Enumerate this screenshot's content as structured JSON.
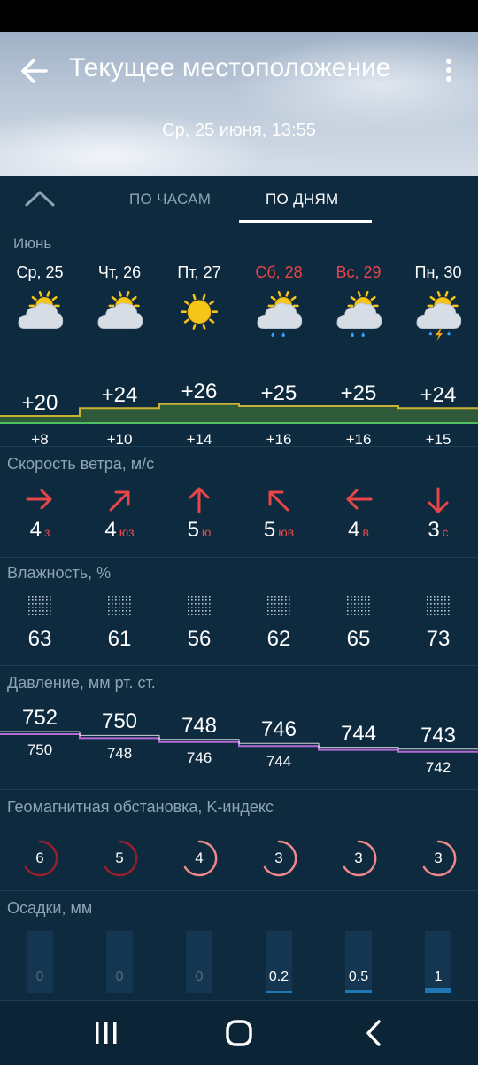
{
  "header": {
    "title": "Текущее местоположение",
    "date": "Ср, 25 июня, 13:55"
  },
  "tabs": {
    "hourly": "ПО ЧАСАМ",
    "daily": "ПО ДНЯМ",
    "active": "daily"
  },
  "month": "Июнь",
  "days": [
    {
      "name": "Ср, 25",
      "weekend": false,
      "icon": "partly-cloudy-icon",
      "tmax": "+20",
      "tmin": "+8",
      "wind_speed": "4",
      "wind_dir": "з",
      "wind_icon": "arrow-right-icon",
      "humidity": "63",
      "p_max": "752",
      "p_min": "750",
      "k_index": "6",
      "precip": "0"
    },
    {
      "name": "Чт, 26",
      "weekend": false,
      "icon": "partly-cloudy-icon",
      "tmax": "+24",
      "tmin": "+10",
      "wind_speed": "4",
      "wind_dir": "юз",
      "wind_icon": "arrow-up-right-icon",
      "humidity": "61",
      "p_max": "750",
      "p_min": "748",
      "k_index": "5",
      "precip": "0"
    },
    {
      "name": "Пт, 27",
      "weekend": false,
      "icon": "sunny-icon",
      "tmax": "+26",
      "tmin": "+14",
      "wind_speed": "5",
      "wind_dir": "ю",
      "wind_icon": "arrow-up-icon",
      "humidity": "56",
      "p_max": "748",
      "p_min": "746",
      "k_index": "4",
      "precip": "0"
    },
    {
      "name": "Сб, 28",
      "weekend": true,
      "icon": "partly-cloudy-rain-icon",
      "tmax": "+25",
      "tmin": "+16",
      "wind_speed": "5",
      "wind_dir": "юв",
      "wind_icon": "arrow-up-left-icon",
      "humidity": "62",
      "p_max": "746",
      "p_min": "744",
      "k_index": "3",
      "precip": "0.2"
    },
    {
      "name": "Вс, 29",
      "weekend": true,
      "icon": "partly-cloudy-rain-icon",
      "tmax": "+25",
      "tmin": "+16",
      "wind_speed": "4",
      "wind_dir": "в",
      "wind_icon": "arrow-left-icon",
      "humidity": "65",
      "p_max": "744",
      "p_min": "",
      "k_index": "3",
      "precip": "0.5"
    },
    {
      "name": "Пн, 30",
      "weekend": false,
      "icon": "partly-cloudy-thunderstorm-icon",
      "tmax": "+24",
      "tmin": "+15",
      "wind_speed": "3",
      "wind_dir": "с",
      "wind_icon": "arrow-down-icon",
      "humidity": "73",
      "p_max": "743",
      "p_min": "742",
      "k_index": "3",
      "precip": "1"
    }
  ],
  "sections": {
    "wind": "Скорость ветра, м/с",
    "humidity": "Влажность, %",
    "pressure": "Давление, мм рт. ст.",
    "geomagnetic": "Геомагнитная обстановка, K-индекс",
    "precipitation": "Осадки, мм"
  },
  "colors": {
    "background": "#0e2a3f",
    "weekend": "#e8474a",
    "temp_band": "#2f5a3a",
    "temp_line": "#c9b233",
    "pressure_line": "#b36bd6",
    "k_high": "#9b1f2a",
    "k_low": "#f08a8a",
    "precip": "#1f77b4"
  }
}
